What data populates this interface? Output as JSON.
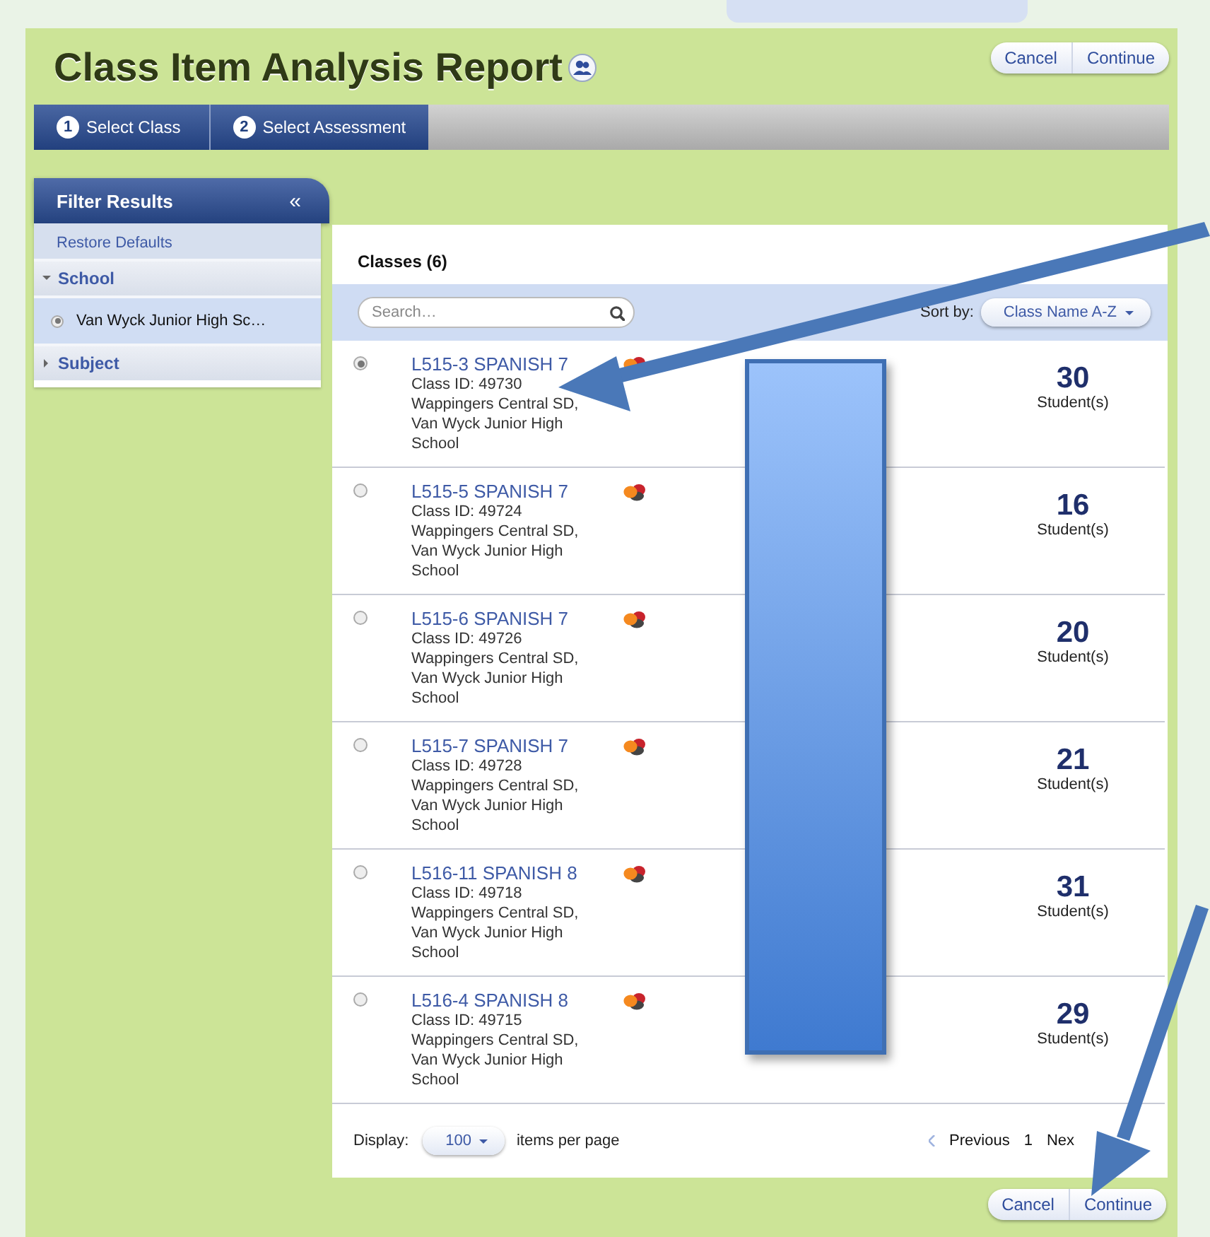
{
  "title": "Class Item Analysis Report",
  "header_buttons": [
    "Cancel",
    "Continue"
  ],
  "steps": [
    {
      "number": "1",
      "label": "Select Class"
    },
    {
      "number": "2",
      "label": "Select Assessment"
    }
  ],
  "filter": {
    "title": "Filter Results",
    "collapse": "«",
    "restore": "Restore Defaults",
    "sections": [
      {
        "label": "School",
        "expanded": true,
        "options": [
          {
            "label": "Van Wyck Junior High Sc…",
            "selected": true
          }
        ]
      },
      {
        "label": "Subject",
        "expanded": false
      }
    ]
  },
  "classes": {
    "heading": "Classes (6)",
    "search": {
      "placeholder": "Search…"
    },
    "sort_label": "Sort by:",
    "sort_value": "Class Name A-Z",
    "rows": [
      {
        "name": "L515-3 SPANISH 7",
        "class_id": "Class ID: 49730",
        "location": "Wappingers Central SD, Van Wyck Junior High School",
        "count": "30",
        "unit": "Student(s)",
        "selected": true
      },
      {
        "name": "L515-5 SPANISH 7",
        "class_id": "Class ID: 49724",
        "location": "Wappingers Central SD, Van Wyck Junior High School",
        "count": "16",
        "unit": "Student(s)",
        "selected": false
      },
      {
        "name": "L515-6 SPANISH 7",
        "class_id": "Class ID: 49726",
        "location": "Wappingers Central SD, Van Wyck Junior High School",
        "count": "20",
        "unit": "Student(s)",
        "selected": false
      },
      {
        "name": "L515-7 SPANISH 7",
        "class_id": "Class ID: 49728",
        "location": "Wappingers Central SD, Van Wyck Junior High School",
        "count": "21",
        "unit": "Student(s)",
        "selected": false
      },
      {
        "name": "L516-11 SPANISH 8",
        "class_id": "Class ID: 49718",
        "location": "Wappingers Central SD, Van Wyck Junior High School",
        "count": "31",
        "unit": "Student(s)",
        "selected": false
      },
      {
        "name": "L516-4 SPANISH 8",
        "class_id": "Class ID: 49715",
        "location": "Wappingers Central SD, Van Wyck Junior High School",
        "count": "29",
        "unit": "Student(s)",
        "selected": false
      }
    ]
  },
  "footer": {
    "display_label": "Display:",
    "page_size": "100",
    "per_page": "items per page",
    "previous": "Previous",
    "page": "1",
    "next": "Nex"
  },
  "footer_buttons": [
    "Cancel",
    "Continue"
  ]
}
